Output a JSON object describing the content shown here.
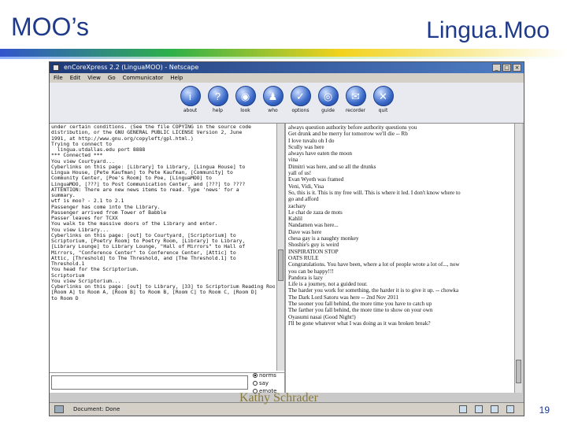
{
  "slide": {
    "title": "MOO’s",
    "header_right": "Lingua.Moo",
    "author": "Kathy Schrader",
    "page_number": "19"
  },
  "browser": {
    "window_title": "enCoreXpress 2.2 (LinguaMOO) - Netscape",
    "window_buttons": [
      "_",
      "□",
      "×"
    ],
    "menu": [
      "File",
      "Edit",
      "View",
      "Go",
      "Communicator",
      "Help"
    ],
    "toolbar": [
      {
        "label": "about",
        "icon": "info-icon",
        "glyph": "i"
      },
      {
        "label": "help",
        "icon": "help-icon",
        "glyph": "?"
      },
      {
        "label": "look",
        "icon": "look-icon",
        "glyph": "◉"
      },
      {
        "label": "who",
        "icon": "who-icon",
        "glyph": "♟"
      },
      {
        "label": "options",
        "icon": "options-icon",
        "glyph": "✓"
      },
      {
        "label": "guide",
        "icon": "guide-icon",
        "glyph": "◎"
      },
      {
        "label": "recorder",
        "icon": "mail-icon",
        "glyph": "✉"
      },
      {
        "label": "quit",
        "icon": "quit-icon",
        "glyph": "✕"
      }
    ],
    "left_log": [
      "under certain conditions. (See the file COPYING in the source code",
      "distribution, or the GNU GENERAL PUBLIC LICENSE Version 2, June",
      "1991, at http://www.gnu.org/copyleft/gpl.html.)",
      "",
      "Trying to connect to",
      "  lingua.utdallas.edu port 8888",
      "*** Connected ***",
      "You view Courtyard...",
      "",
      "Cyberlinks on this page: [Library] to Library, [Lingua House] to",
      "Lingua House, [Pete Kaufman] to Pete Kaufman, [Community] to",
      "Community Center, [Poe's Room] to Poe, [LinguaMOO] to",
      "LinguaMOO, [???] to Post Communication Center, and [???] to ????",
      "ATTENTION: There are new news items to read. Type 'news' for a",
      "summary.",
      "wtf is moo? - 2.1 to 2.1",
      "Passenger has come into the Library.",
      "Passenger arrived from Tower of Babble",
      "Passer leaves for TCXX",
      "You walk to the massive doors of the Library and enter.",
      "You view Library...",
      "Cyberlinks on this page: [out] to Courtyard, [Scriptorium] to",
      "Scriptorium, [Poetry Room] to Poetry Room, [Library] to Library,",
      "[Library Lounge] to Library Lounge, \"Hall of Mirrors\" to Hall of",
      "Mirrors, \"Conference Center\" to Conference Center, [Attic] to",
      "Attic, [Threshold] to The Threshold, and [The Threshold.1] to",
      "Threshold.1",
      "You head for the Scriptorium.",
      "Scriptorium",
      "You view Scriptorium...",
      "",
      "Cyberlinks on this page: [out] to Library, [33] to Scriptorium Reading Room,",
      "[Room A] to Room A, [Room B] to Room B, [Room C] to Room C, [Room D]",
      "to Room D"
    ],
    "input": {
      "value": ""
    },
    "radio_options": [
      {
        "label": "norms",
        "selected": true
      },
      {
        "label": "say",
        "selected": false
      },
      {
        "label": "emote",
        "selected": false
      }
    ],
    "right_log": [
      "always question authority before authority questions you",
      "Get drunk and be merry for tomorrow we'll die -- Rb",
      "I love tuvalu oh I do",
      "Scully was here",
      "always have eaten the moon",
      "vina",
      "Dimitri was here, and so all the drunks",
      "yall of us!",
      "Evan Wyeth was framed",
      "Veni, Vidi, Visa",
      "So, this is it. This is my free will. This is where it led. I don't know where to",
      "go and afford",
      "zachary",
      "Le chat de zaza de mots",
      "Kahlil",
      "Nandamen was here...",
      "Dave was here",
      "chesa gay is a naughty monkey",
      "Shoshie's guy is weird",
      "INSPIRATION STOP",
      "OATS RULE",
      "Congratulations. You have been, where a lot of people wrote a lot of..., now",
      "you can be happy!!!",
      "Pandora is lazy",
      "Life is a journey, not a guided tour.",
      "The harder you work for something, the harder it is to give it up. -- chowka",
      "The Dark Lord Satoru was here -- 2nd Nov 2011",
      "The sooner you fall behind, the more time you have to catch up",
      "The farther you fall behind, the more time to show on your own",
      "Oyasumi nasai (Good Night!)",
      "I'll be gone whatever what I was doing as it was broken break?"
    ],
    "status_text": "Document: Done"
  }
}
